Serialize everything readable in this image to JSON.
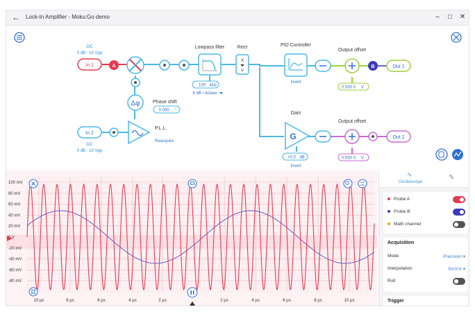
{
  "window": {
    "title": "Lock-In Amplifier - Moku:Go demo",
    "back_icon": "arrow-left-icon",
    "minimize": "–",
    "maximize": "□",
    "close": "✕"
  },
  "block": {
    "in1": {
      "label": "In 1",
      "dc": "DC",
      "range": "0 dB : 10 Vpp"
    },
    "in2": {
      "label": "In 2",
      "dc": "DC",
      "range": "0 dB : 10 Vpp"
    },
    "probe_a": "A",
    "probe_b": "B",
    "lowpass": {
      "title": "Lowpass filter",
      "freq": "100",
      "unit": "kHz",
      "slope": "6 dB / octave"
    },
    "rect": {
      "title": "Rect",
      "x": "X",
      "y": "Y"
    },
    "pid": {
      "title": "PID Controller",
      "invert": "Invert"
    },
    "output_offset_1": {
      "title": "Output offset",
      "value": "0.000 0",
      "unit": "V"
    },
    "output_offset_2": {
      "title": "Output offset",
      "value": "0.000 0",
      "unit": "V"
    },
    "out1": "Out 1",
    "out2": "Out 2",
    "phase": {
      "title": "Phase shift",
      "value": "0.000",
      "unit": "°",
      "symbol": "Δφ"
    },
    "pll": {
      "title": "P.L.L.",
      "reacquire": "Reacquire"
    },
    "gain": {
      "title": "Gain",
      "symbol": "G",
      "value": "+0.0",
      "unit": "dB",
      "invert": "Invert"
    }
  },
  "scope": {
    "y_ticks": [
      "100 mV",
      "80 mV",
      "60 mV",
      "40 mV",
      "20 mV",
      "0 V",
      "-20 mV",
      "-40 mV",
      "-60 mV",
      "-80 mV"
    ],
    "x_ticks": [
      "10 µs",
      "8 µs",
      "6 µs",
      "4 µs",
      "2 µs",
      "2 µs",
      "4 µs",
      "6 µs",
      "8 µs",
      "10 µs"
    ],
    "probe_a_color": "#e8394f",
    "probe_b_color": "#4c4fc4"
  },
  "panel": {
    "tab_oscilloscope": "Oscilloscope",
    "tab_oscilloscope_icon": "waveform-icon",
    "tab_edit_icon": "pencil-icon",
    "probe_a": {
      "label": "Probe A",
      "on": true,
      "color": "#e8394f"
    },
    "probe_b": {
      "label": "Probe B",
      "on": true,
      "color": "#4c4fc4"
    },
    "math": {
      "label": "Math channel",
      "on": false,
      "color": "#f0a020"
    },
    "acquisition": {
      "title": "Acquisition",
      "mode_label": "Mode",
      "mode_value": "Precision ▾",
      "interp_label": "Interpolation",
      "interp_value": "SinX/X ▾",
      "roll_label": "Roll",
      "roll_on": false
    },
    "trigger": {
      "title": "Trigger"
    }
  }
}
